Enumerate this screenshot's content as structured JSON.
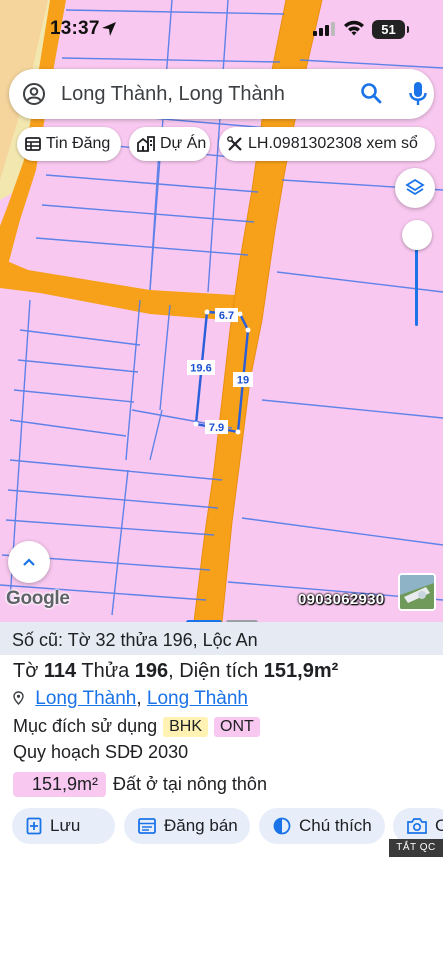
{
  "status_bar": {
    "time": "13:37",
    "battery": "51"
  },
  "search": {
    "value": "Long Thành, Long Thành"
  },
  "chips": [
    {
      "label": "Tin Đăng",
      "icon": "table-icon"
    },
    {
      "label": "Dự Án",
      "icon": "buildings-icon"
    },
    {
      "label": "LH.0981302308 xem sổ",
      "icon": "tools-icon"
    }
  ],
  "map": {
    "plot_labels": {
      "top": "6.7",
      "left": "19.6",
      "right": "19",
      "bottom": "7.9"
    },
    "logo": "Google",
    "phone_overlay": "0903062930",
    "colors": {
      "land": "#f8c8f0",
      "road": "#f7a11a",
      "parcel_line": "#1a73e8",
      "plot_border": "#2b5fd9"
    },
    "zoom_level": 0.3
  },
  "parcel": {
    "old_info": "Số cũ: Tờ 32 thửa 196, Lộc An",
    "sheet_label": "Tờ",
    "sheet": "114",
    "lot_label": "Thửa",
    "lot": "196",
    "area_label": "Diện tích",
    "area": "151,9m²",
    "location": [
      "Long Thành",
      "Long Thành"
    ],
    "purpose_label": "Mục đích sử dụng",
    "purpose_tags": [
      "BHK",
      "ONT"
    ],
    "plan_label": "Quy hoạch SDĐ 2030",
    "plan_area": "151,9m²",
    "plan_desc": "Đất ở tại nông thôn"
  },
  "actions": [
    {
      "label": "Lưu",
      "icon": "bookmark-plus-icon"
    },
    {
      "label": "Đăng bán",
      "icon": "listing-icon"
    },
    {
      "label": "Chú thích",
      "icon": "half-circle-icon"
    },
    {
      "label": "C",
      "icon": "camera-plus-icon"
    }
  ],
  "ad_tag": "TẮT QC"
}
